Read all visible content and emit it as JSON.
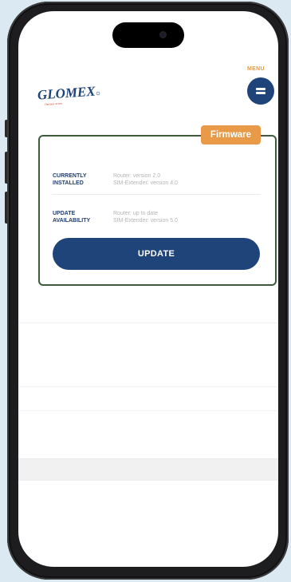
{
  "header": {
    "logo_text": "GLOMEX",
    "logo_tagline": "The best at sea",
    "menu_label": "MENU",
    "menu_icon": "hamburger-icon"
  },
  "firmware_card": {
    "tag": "Firmware",
    "rows": [
      {
        "label": "CURRENTLY INSTALLED",
        "values": [
          "Router: version 2.0",
          "SIM-Extender: version 4.0"
        ]
      },
      {
        "label": "UPDATE AVAILABILITY",
        "values": [
          "Router: up to date",
          "SIM-Extender: version 5.0"
        ]
      }
    ],
    "button_label": "UPDATE"
  },
  "colors": {
    "navy": "#1f4479",
    "orange": "#e89a48",
    "card_border": "#3e5b3c"
  }
}
